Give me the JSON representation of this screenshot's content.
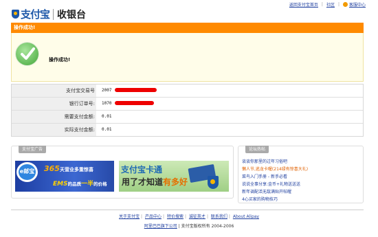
{
  "header": {
    "logo_text": "支付宝",
    "page_name": "收银台",
    "nav": {
      "home_link": "返回支付宝首页",
      "community_link": "社区",
      "help_link": "客服中心"
    }
  },
  "status": {
    "bar_title": "操作成功!",
    "message": "操作成功!"
  },
  "info_rows": [
    {
      "label": "支付宝交易号",
      "value": "2007"
    },
    {
      "label": "银行订单号:",
      "value": "1070"
    },
    {
      "label": "需要支付金额:",
      "value": "0.01"
    },
    {
      "label": "实际支付金额:",
      "value": "0.01"
    }
  ],
  "ads": {
    "tab_label": "支付宝广告",
    "ad1": {
      "circle_text": "e邮宝",
      "headline_num": "365",
      "headline_text": "天营业多重惊喜",
      "sub_ems": "EMS",
      "sub_text_a": "的品质",
      "sub_half": "一半",
      "sub_text_b": "的价格"
    },
    "ad2": {
      "line1": "支付宝卡通",
      "line2_a": "用了才知道",
      "line2_b": "有多好"
    }
  },
  "forum": {
    "tab_label": "论坛热帖",
    "items": [
      {
        "text": "谈谈你那里的过年习俗吧",
        "hot": false
      },
      {
        "text": "懒人节,逃龙卡喔(214绿有惊喜大礼)",
        "hot": true
      },
      {
        "text": "菜鸟入门手册 - 新手必看",
        "hot": false
      },
      {
        "text": "说说全事分享:金币+礼物送送送",
        "hot": false
      },
      {
        "text": "新年调配活无敌满贴开帖喔",
        "hot": false
      },
      {
        "text": "4心买家的购物技巧",
        "hot": false
      }
    ]
  },
  "footer": {
    "links": [
      "关于支付宝",
      "产品中心",
      "特价搜索",
      "诚征英才",
      "联系我们",
      "About Alipay"
    ],
    "company_link": "阿里巴巴旗下公司",
    "copyright_text": "| 支付宝版权所有 2004-2006"
  },
  "colors": {
    "accent": "#ff8a00",
    "brand": "#1d57a8",
    "success_bg": "#fffde9",
    "redaction": "#e00000"
  }
}
